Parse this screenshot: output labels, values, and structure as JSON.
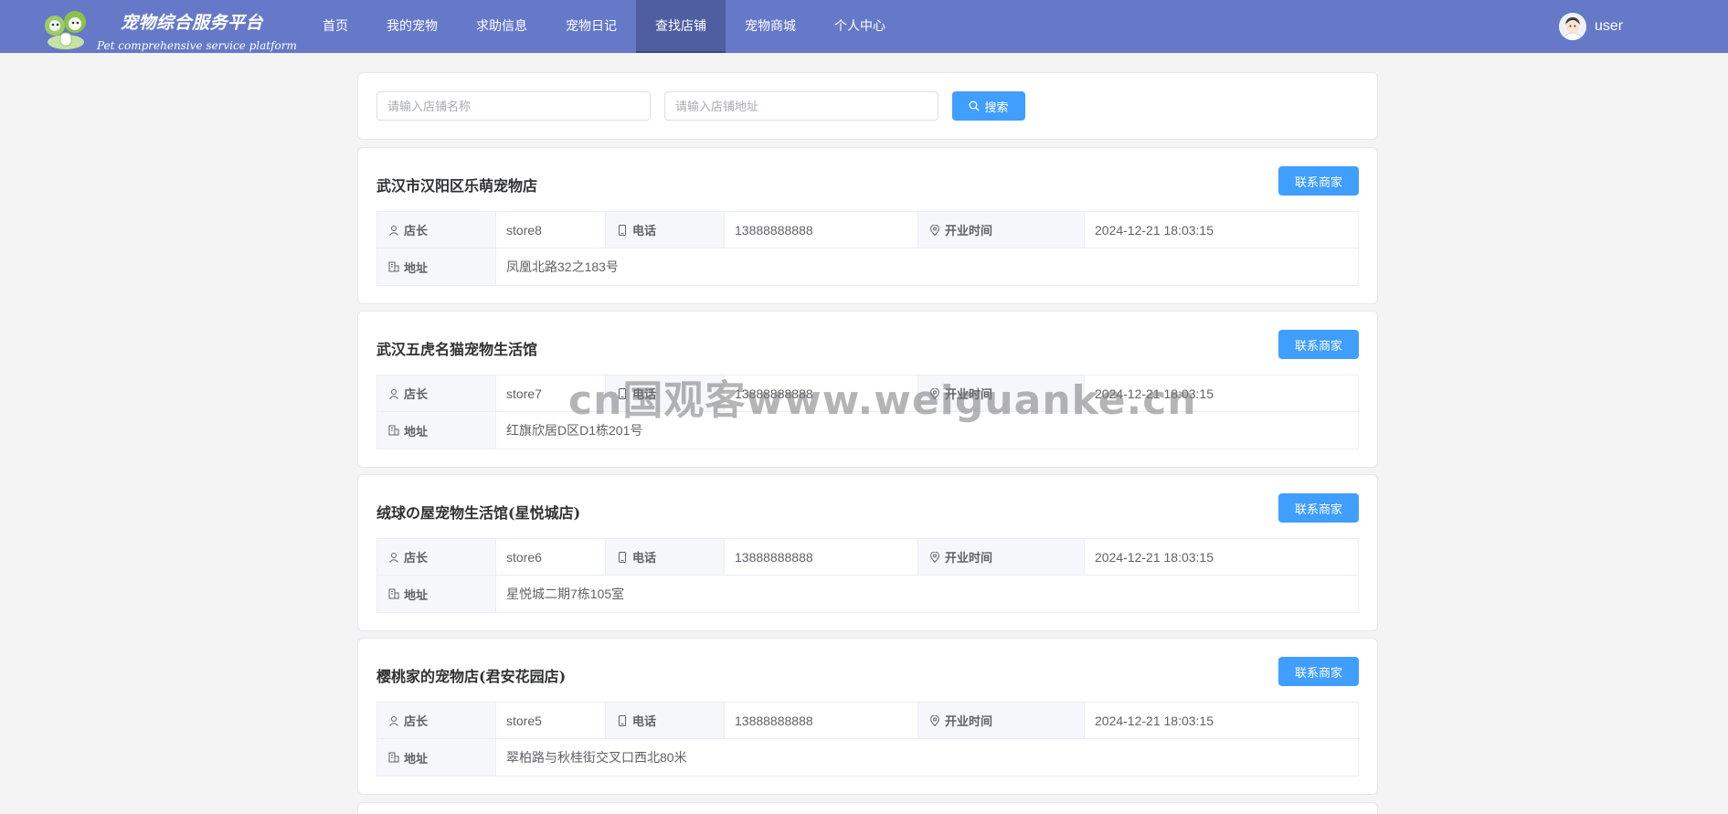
{
  "header": {
    "brand_title": "宠物综合服务平台",
    "brand_subtitle": "Pet comprehensive service platform",
    "nav": [
      "首页",
      "我的宠物",
      "求助信息",
      "宠物日记",
      "查找店铺",
      "宠物商城",
      "个人中心"
    ],
    "active_nav": "查找店铺",
    "user_name": "user"
  },
  "search": {
    "name_placeholder": "请输入店铺名称",
    "address_placeholder": "请输入店铺地址",
    "button_label": "搜索"
  },
  "labels": {
    "owner": "店长",
    "phone": "电话",
    "open_time": "开业时间",
    "address": "地址",
    "contact": "联系商家"
  },
  "stores": [
    {
      "name": "武汉市汉阳区乐萌宠物店",
      "owner": "store8",
      "phone": "13888888888",
      "open_time": "2024-12-21 18:03:15",
      "address": "凤凰北路32之183号"
    },
    {
      "name": "武汉五虎名猫宠物生活馆",
      "owner": "store7",
      "phone": "13888888888",
      "open_time": "2024-12-21 18:03:15",
      "address": "红旗欣居D区D1栋201号"
    },
    {
      "name": "绒球の屋宠物生活馆(星悦城店)",
      "owner": "store6",
      "phone": "13888888888",
      "open_time": "2024-12-21 18:03:15",
      "address": "星悦城二期7栋105室"
    },
    {
      "name": "樱桃家的宠物店(君安花园店)",
      "owner": "store5",
      "phone": "13888888888",
      "open_time": "2024-12-21 18:03:15",
      "address": "翠柏路与秋桂街交叉口西北80米"
    }
  ],
  "watermark": "cn国观客www.weiguanke.cn",
  "colors": {
    "header": "#6579c8",
    "primary": "#409eff",
    "background": "#f4f4f5"
  }
}
